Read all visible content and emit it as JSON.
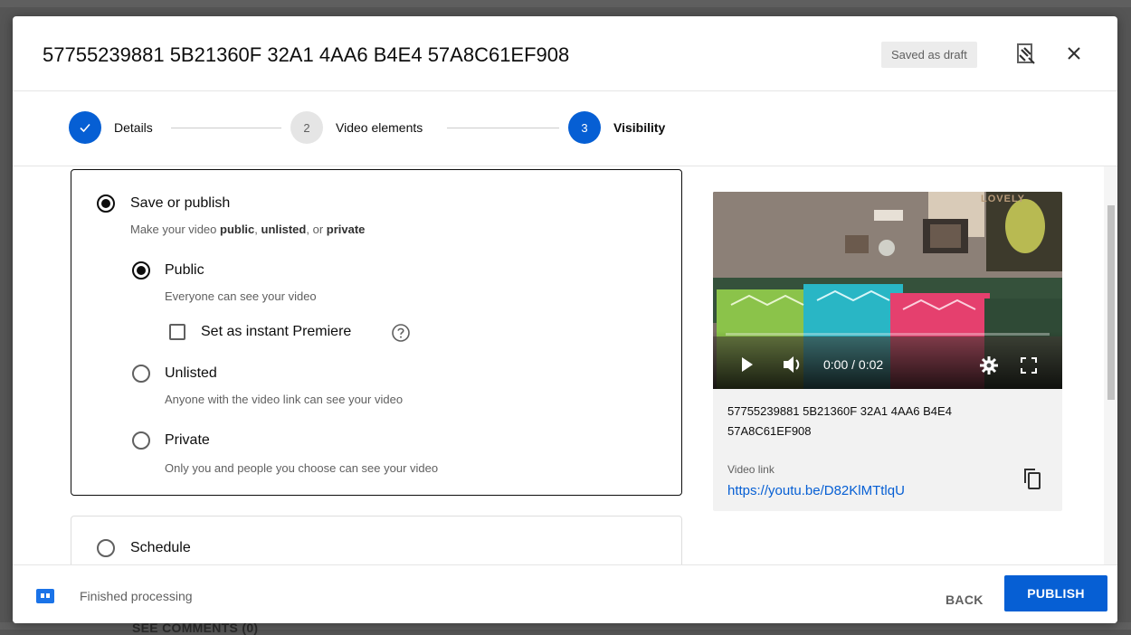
{
  "dialog": {
    "title": "57755239881 5B21360F 32A1 4AA6 B4E4 57A8C61EF908",
    "draft_badge": "Saved as draft"
  },
  "steps": [
    {
      "label": "Details",
      "number": "",
      "state": "done"
    },
    {
      "label": "Video elements",
      "number": "2",
      "state": "pending"
    },
    {
      "label": "Visibility",
      "number": "3",
      "state": "active"
    }
  ],
  "save_publish": {
    "label": "Save or publish",
    "desc_prefix": "Make your video ",
    "desc_public": "public",
    "desc_sep1": ", ",
    "desc_unlisted": "unlisted",
    "desc_sep2": ", or ",
    "desc_private": "private",
    "selected": true
  },
  "visibility_options": {
    "public": {
      "label": "Public",
      "desc": "Everyone can see your video",
      "selected": true
    },
    "premiere": {
      "label": "Set as instant Premiere",
      "checked": false
    },
    "unlisted": {
      "label": "Unlisted",
      "desc": "Anyone with the video link can see your video",
      "selected": false
    },
    "private": {
      "label": "Private",
      "desc": "Only you and people you choose can see your video",
      "selected": false
    }
  },
  "schedule": {
    "label": "Schedule",
    "selected": false
  },
  "preview": {
    "time": "0:00 / 0:02",
    "title": "57755239881 5B21360F 32A1 4AA6 B4E4 57A8C61EF908",
    "link_label": "Video link",
    "link": "https://youtu.be/D82KlMTtlqU",
    "thumbnail_sign": "LOVELY"
  },
  "footer": {
    "status": "Finished processing",
    "back_label": "BACK",
    "publish_label": "PUBLISH"
  },
  "backdrop": {
    "text": "SEE COMMENTS (0)"
  },
  "colors": {
    "accent": "#065fd4",
    "text": "#0d0d0d",
    "secondary": "#606060"
  }
}
